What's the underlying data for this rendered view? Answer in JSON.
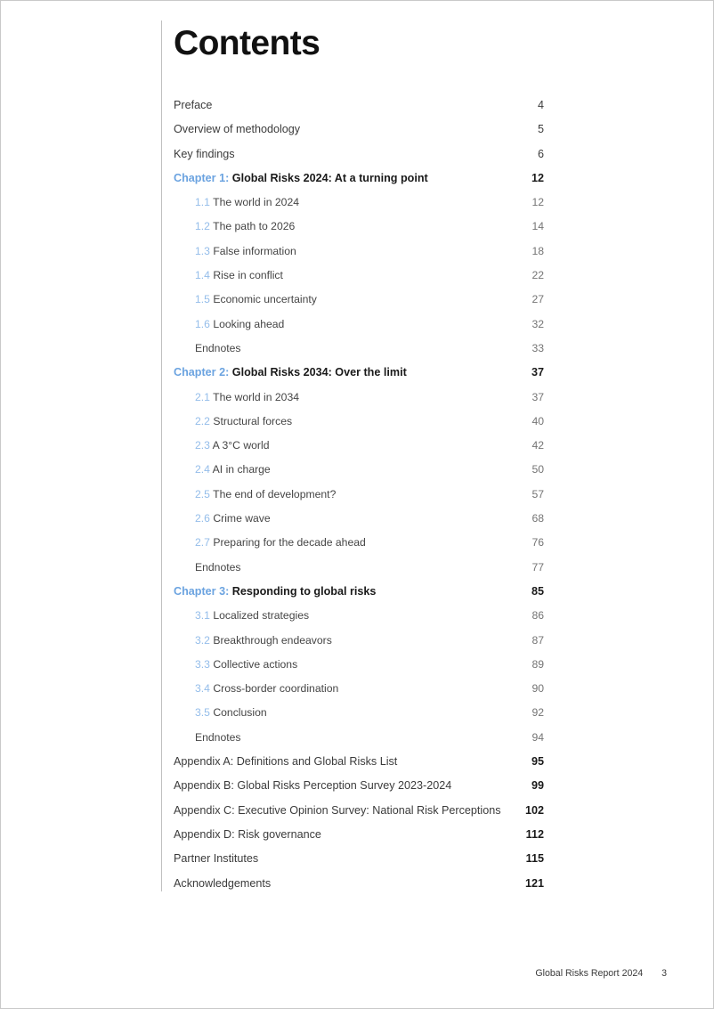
{
  "page": {
    "title": "Contents",
    "footer_text": "Global Risks Report 2024",
    "footer_page_number": "3"
  },
  "colors": {
    "chapter_tag_blue": "#6ba3e0",
    "subsection_number_blue": "#94bdea",
    "body_text": "#3b3b3b",
    "sub_text": "#454545",
    "page_number_gray": "#747474",
    "rule_gray": "#c0c0c0"
  },
  "toc": {
    "entries": [
      {
        "type": "top",
        "label": "Preface",
        "page": "4"
      },
      {
        "type": "top",
        "label": "Overview of methodology",
        "page": "5"
      },
      {
        "type": "top",
        "label": "Key findings",
        "page": "6"
      },
      {
        "type": "chapter",
        "tag": "Chapter 1:",
        "label": "Global Risks 2024: At a turning point",
        "page": "12"
      },
      {
        "type": "sub",
        "num": "1.1",
        "label": "The world in 2024",
        "page": "12"
      },
      {
        "type": "sub",
        "num": "1.2",
        "label": "The path to 2026",
        "page": "14"
      },
      {
        "type": "sub",
        "num": "1.3",
        "label": "False information",
        "page": "18"
      },
      {
        "type": "sub",
        "num": "1.4",
        "label": "Rise in conflict",
        "page": "22"
      },
      {
        "type": "sub",
        "num": "1.5",
        "label": "Economic uncertainty",
        "page": "27"
      },
      {
        "type": "sub",
        "num": "1.6",
        "label": "Looking ahead",
        "page": "32"
      },
      {
        "type": "endnote",
        "label": "Endnotes",
        "page": "33"
      },
      {
        "type": "chapter",
        "tag": "Chapter 2:",
        "label": "Global Risks 2034: Over the limit",
        "page": "37"
      },
      {
        "type": "sub",
        "num": "2.1",
        "label": "The world in 2034",
        "page": "37"
      },
      {
        "type": "sub",
        "num": "2.2",
        "label": "Structural forces",
        "page": "40"
      },
      {
        "type": "sub",
        "num": "2.3",
        "label": "A 3°C world",
        "page": "42"
      },
      {
        "type": "sub",
        "num": "2.4",
        "label": "AI in charge",
        "page": "50"
      },
      {
        "type": "sub",
        "num": "2.5",
        "label": "The end of development?",
        "page": "57"
      },
      {
        "type": "sub",
        "num": "2.6",
        "label": "Crime wave",
        "page": "68"
      },
      {
        "type": "sub",
        "num": "2.7",
        "label": "Preparing for the decade ahead",
        "page": "76"
      },
      {
        "type": "endnote",
        "label": "Endnotes",
        "page": "77"
      },
      {
        "type": "chapter",
        "tag": "Chapter 3:",
        "label": "Responding to global risks",
        "page": "85"
      },
      {
        "type": "sub",
        "num": "3.1",
        "label": "Localized strategies",
        "page": "86"
      },
      {
        "type": "sub",
        "num": "3.2",
        "label": "Breakthrough endeavors",
        "page": "87"
      },
      {
        "type": "sub",
        "num": "3.3",
        "label": "Collective actions",
        "page": "89"
      },
      {
        "type": "sub",
        "num": "3.4",
        "label": "Cross-border coordination",
        "page": "90"
      },
      {
        "type": "sub",
        "num": "3.5",
        "label": "Conclusion",
        "page": "92"
      },
      {
        "type": "endnote",
        "label": "Endnotes",
        "page": "94"
      },
      {
        "type": "top",
        "bold_page": true,
        "label": "Appendix A: Definitions and Global Risks List",
        "page": "95"
      },
      {
        "type": "top",
        "bold_page": true,
        "label": "Appendix B: Global Risks Perception Survey 2023-2024",
        "page": "99"
      },
      {
        "type": "top",
        "bold_page": true,
        "label": "Appendix C: Executive Opinion Survey: National Risk Perceptions",
        "page": "102"
      },
      {
        "type": "top",
        "bold_page": true,
        "label": "Appendix D: Risk governance",
        "page": "112"
      },
      {
        "type": "top",
        "bold_page": true,
        "label": "Partner Institutes",
        "page": "115"
      },
      {
        "type": "top",
        "bold_page": true,
        "label": "Acknowledgements",
        "page": "121"
      }
    ]
  }
}
